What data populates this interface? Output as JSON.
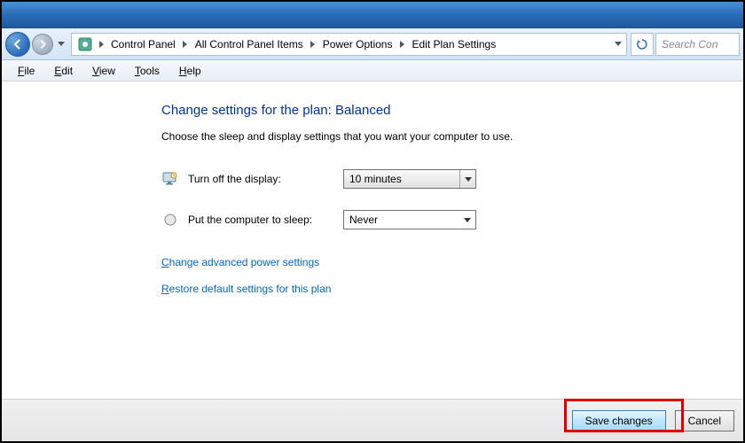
{
  "breadcrumb": {
    "items": [
      "Control Panel",
      "All Control Panel Items",
      "Power Options",
      "Edit Plan Settings"
    ]
  },
  "search": {
    "placeholder": "Search Con"
  },
  "menubar": {
    "file": "File",
    "edit": "Edit",
    "view": "View",
    "tools": "Tools",
    "help": "Help"
  },
  "page": {
    "title": "Change settings for the plan: Balanced",
    "description": "Choose the sleep and display settings that you want your computer to use."
  },
  "settings": {
    "display_label": "Turn off the display:",
    "display_value": "10 minutes",
    "sleep_label": "Put the computer to sleep:",
    "sleep_value": "Never"
  },
  "links": {
    "advanced": "Change advanced power settings",
    "restore": "Restore default settings for this plan"
  },
  "buttons": {
    "save": "Save changes",
    "cancel": "Cancel"
  }
}
